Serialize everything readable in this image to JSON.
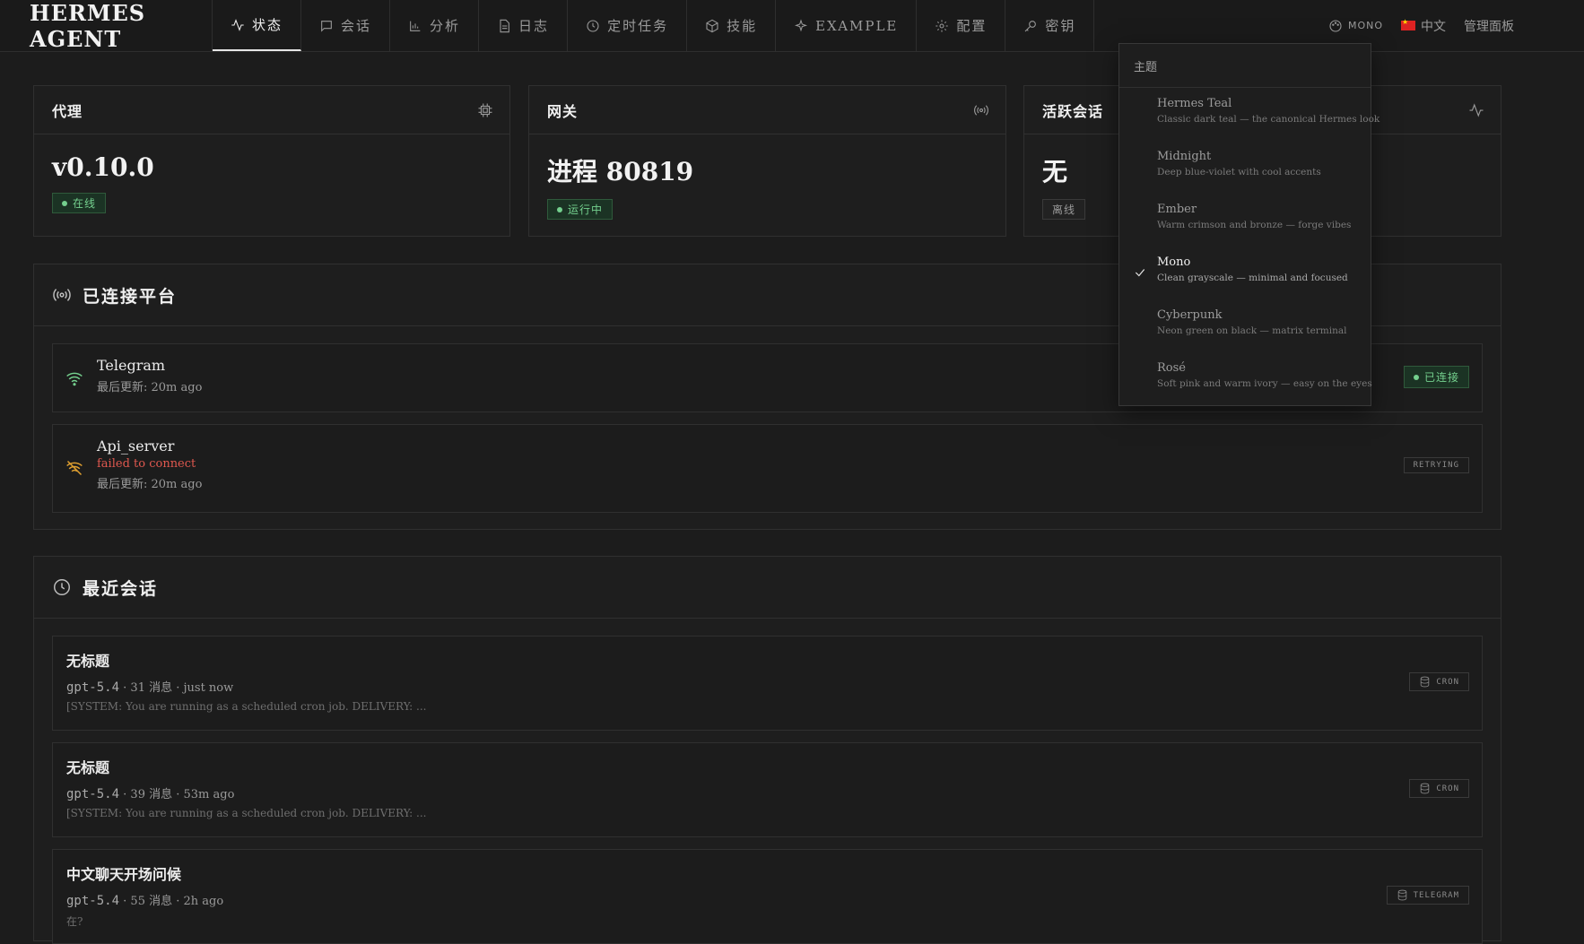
{
  "brand": "HERMES AGENT",
  "nav": [
    {
      "label": "状态",
      "icon": "activity-icon"
    },
    {
      "label": "会话",
      "icon": "chat-icon"
    },
    {
      "label": "分析",
      "icon": "bar-chart-icon"
    },
    {
      "label": "日志",
      "icon": "document-icon"
    },
    {
      "label": "定时任务",
      "icon": "clock-icon"
    },
    {
      "label": "技能",
      "icon": "cube-icon"
    },
    {
      "label": "EXAMPLE",
      "icon": "sparkle-icon"
    },
    {
      "label": "配置",
      "icon": "gear-icon"
    },
    {
      "label": "密钥",
      "icon": "key-icon"
    }
  ],
  "header_tools": {
    "theme_label": "MONO",
    "language": "中文",
    "admin": "管理面板"
  },
  "cards": {
    "agent": {
      "title": "代理",
      "value": "v0.10.0",
      "badge": "在线"
    },
    "gateway": {
      "title": "网关",
      "value": "进程 80819",
      "badge": "运行中"
    },
    "sessions": {
      "title": "活跃会话",
      "value": "无",
      "badge": "离线"
    }
  },
  "platforms": {
    "title": "已连接平台",
    "items": [
      {
        "name": "Telegram",
        "updated": "最后更新: 20m ago",
        "error": "",
        "status": "已连接"
      },
      {
        "name": "Api_server",
        "updated": "最后更新: 20m ago",
        "error": "failed to connect",
        "status": "RETRYING"
      }
    ]
  },
  "recent": {
    "title": "最近会话",
    "items": [
      {
        "title": "无标题",
        "model": "gpt-5.4",
        "meta": "· 31 消息 · just now",
        "preview": "[SYSTEM: You are running as a scheduled cron job. DELIVERY: ...",
        "source": "CRON"
      },
      {
        "title": "无标题",
        "model": "gpt-5.4",
        "meta": "· 39 消息 · 53m ago",
        "preview": "[SYSTEM: You are running as a scheduled cron job. DELIVERY: ...",
        "source": "CRON"
      },
      {
        "title": "中文聊天开场问候",
        "model": "gpt-5.4",
        "meta": "· 55 消息 · 2h ago",
        "preview": "在?",
        "source": "TELEGRAM"
      }
    ]
  },
  "theme_menu": {
    "title": "主题",
    "selected": "Mono",
    "options": [
      {
        "name": "Hermes Teal",
        "desc": "Classic dark teal — the canonical Hermes look"
      },
      {
        "name": "Midnight",
        "desc": "Deep blue-violet with cool accents"
      },
      {
        "name": "Ember",
        "desc": "Warm crimson and bronze — forge vibes"
      },
      {
        "name": "Mono",
        "desc": "Clean grayscale — minimal and focused"
      },
      {
        "name": "Cyberpunk",
        "desc": "Neon green on black — matrix terminal"
      },
      {
        "name": "Rosé",
        "desc": "Soft pink and warm ivory — easy on the eyes"
      }
    ]
  },
  "colors": {
    "background": "#1c1c1c",
    "ok_green": "#74d08e",
    "error_red": "#e0584f",
    "warning_orange": "#e0a030"
  }
}
